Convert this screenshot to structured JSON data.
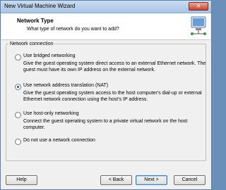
{
  "window": {
    "title": "New Virtual Machine Wizard",
    "close_glyph": "✕"
  },
  "header": {
    "title": "Network Type",
    "subtitle": "What type of network do you want to add?",
    "icon": "network-icon"
  },
  "group": {
    "legend": "Network connection",
    "options": [
      {
        "label": "Use bridged networking",
        "selected": false,
        "desc": "Give the guest operating system direct access to an external Ethernet network. The guest must have its own IP address on the external network."
      },
      {
        "label": "Use network address translation (NAT)",
        "selected": true,
        "desc": "Give the guest operating system access to the host computer's dial-up or external Ethernet network connection using the host's IP address."
      },
      {
        "label": "Use host-only networking",
        "selected": false,
        "desc": "Connect the guest operating system to a private virtual network on the host computer."
      },
      {
        "label": "Do not use a network connection",
        "selected": false,
        "desc": ""
      }
    ]
  },
  "buttons": {
    "help": "Help",
    "back": "< Back",
    "next": "Next >",
    "cancel": "Cancel"
  },
  "colors": {
    "titlebar": "#a9c4e4",
    "selected_radio": "#1a4fa8"
  }
}
